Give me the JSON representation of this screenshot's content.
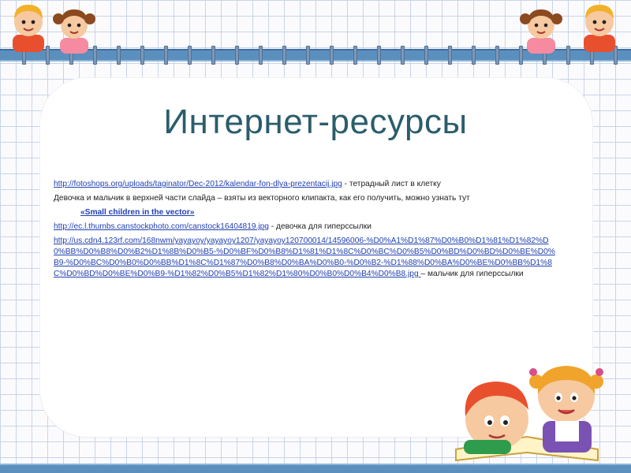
{
  "title": "Интернет-ресурсы",
  "lines": [
    {
      "link": "http://fotoshops.org/uploads/taginator/Dec-2012/kalendar-fon-dlya-prezentacij.jpg",
      "text": " - тетрадный лист в клетку"
    },
    {
      "text": "Девочка и мальчик в верхней части слайда – взяты из векторного клипакта, как его получить, можно узнать тут"
    },
    {
      "link": "«Small children in the vector»"
    },
    {
      "link": "http://ec.l.thumbs.canstockphoto.com/canstock16404819.jpg",
      "text": " - девочка для гиперссылки"
    },
    {
      "link": "http://us.cdn4.123rf.com/168nwm/yayayoy/yayayoy1207/yayayoy120700014/14596006-%D0%A1%D1%87%D0%B0%D1%81%D1%82%D0%BB%D0%B8%D0%B2%D1%8B%D0%B5-%D0%BF%D0%B8%D1%81%D1%8C%D0%BC%D0%B5%D0%BD%D0%BD%D0%BE%D0%B9-%D0%BC%D0%B0%D0%BB%D1%8C%D1%87%D0%B8%D0%BA%D0%B0-%D0%B2-%D1%88%D0%BA%D0%BE%D0%BB%D1%8C%D0%BD%D0%BE%D0%B9-%D1%82%D0%B5%D1%82%D1%80%D0%B0%D0%B4%D0%B8.jpg ",
      "text": " – мальчик для гиперссылки"
    }
  ],
  "colors": {
    "title": "#2b5d6c",
    "link": "#1f3fb0",
    "band": "#5b8fbd",
    "grid": "#c9d4e8"
  },
  "decor": {
    "top_left": [
      "boy-figure",
      "girl-figure"
    ],
    "top_right": [
      "girl-figure",
      "boy-figure"
    ],
    "bottom_right": [
      "boy-reading-figure",
      "girl-figure"
    ]
  }
}
